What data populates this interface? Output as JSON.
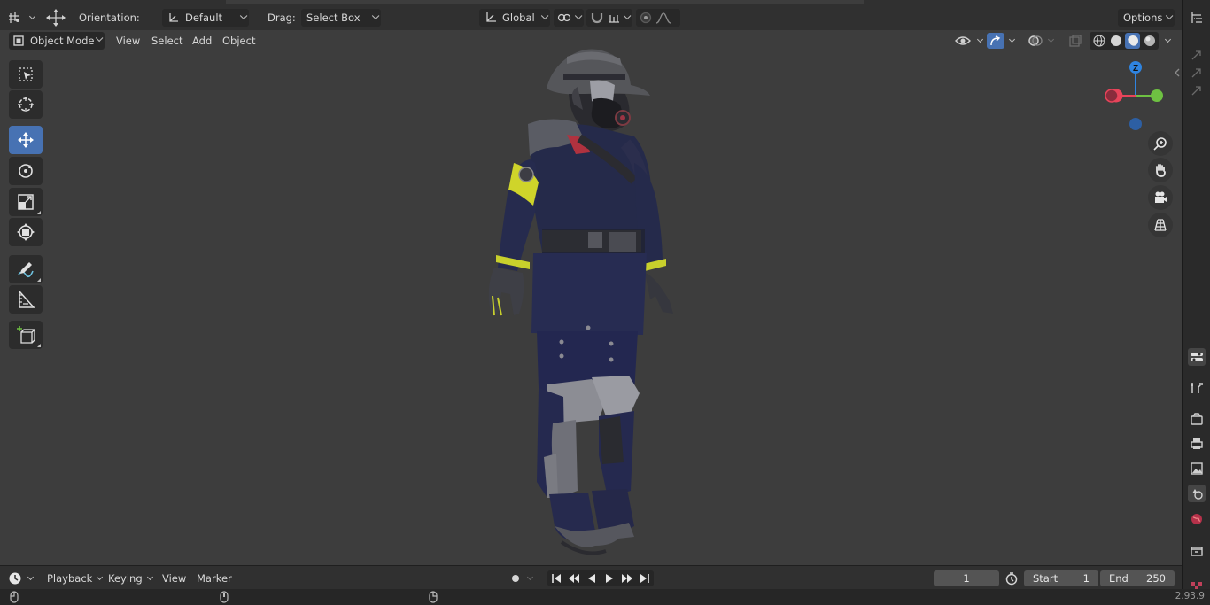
{
  "header": {
    "orientation_label": "Orientation:",
    "orientation_value": "Default",
    "drag_label": "Drag:",
    "drag_value": "Select Box",
    "transform_space": "Global",
    "options_label": "Options"
  },
  "viewport_header": {
    "mode": "Object Mode",
    "menus": [
      "View",
      "Select",
      "Add",
      "Object"
    ]
  },
  "gizmo": {
    "z_label": "Z"
  },
  "tools": [
    {
      "name": "select-box-tool",
      "icon": "select-box-icon"
    },
    {
      "name": "cursor-tool",
      "icon": "cursor-icon"
    },
    {
      "name": "move-tool",
      "icon": "move-icon",
      "active": true
    },
    {
      "name": "rotate-tool",
      "icon": "rotate-icon"
    },
    {
      "name": "scale-tool",
      "icon": "scale-icon"
    },
    {
      "name": "transform-tool",
      "icon": "transform-icon"
    },
    {
      "name": "annotate-tool",
      "icon": "annotate-icon"
    },
    {
      "name": "measure-tool",
      "icon": "measure-icon"
    },
    {
      "name": "add-cube-tool",
      "icon": "add-cube-icon"
    }
  ],
  "timeline": {
    "menus": [
      "Playback",
      "Keying",
      "View",
      "Marker"
    ],
    "current_frame": "1",
    "start_label": "Start",
    "start_value": "1",
    "end_label": "End",
    "end_value": "250"
  },
  "status": {
    "version": "2.93.9"
  },
  "colors": {
    "accent": "#4772b3",
    "viewport_bg": "#3d3d3d",
    "axis_x": "#e8445a",
    "axis_y": "#6ec142",
    "axis_z": "#2f84e0"
  }
}
